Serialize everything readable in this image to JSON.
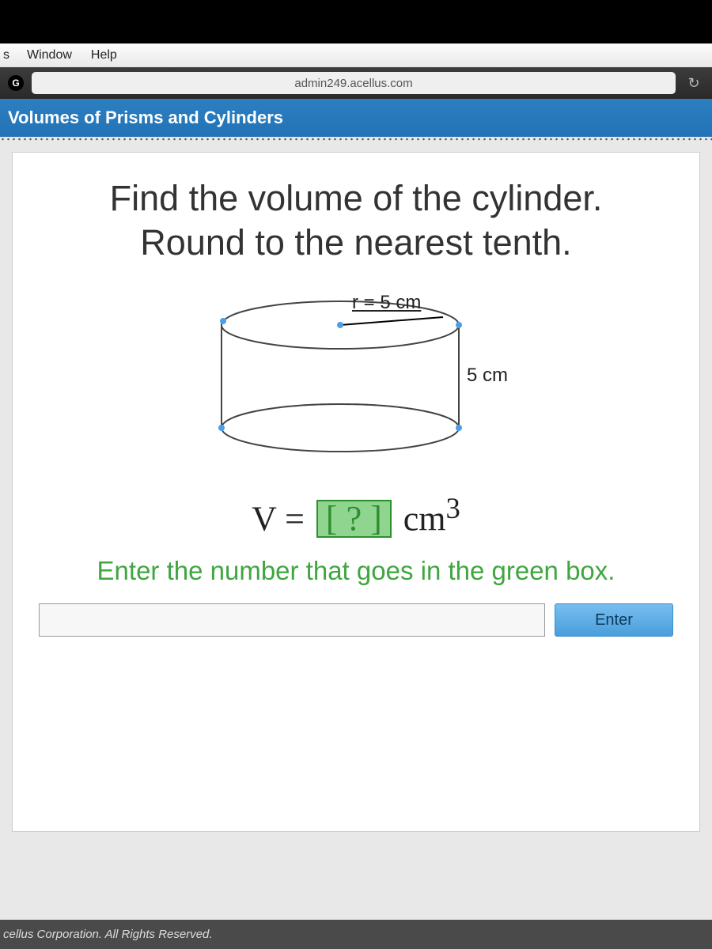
{
  "menubar": {
    "cut_item": "s",
    "item1": "Window",
    "item2": "Help"
  },
  "browser": {
    "url": "admin249.acellus.com"
  },
  "header": {
    "title": "Volumes of Prisms and Cylinders"
  },
  "problem": {
    "line1": "Find the volume of the cylinder.",
    "line2": "Round to the nearest tenth.",
    "radius_label": "r = 5 cm",
    "height_label": "5 cm",
    "formula_prefix": "V = ",
    "formula_placeholder": "?",
    "formula_suffix_unit": " cm",
    "formula_exponent": "3",
    "hint": "Enter the number that goes in the green box.",
    "enter_button": "Enter",
    "answer_value": ""
  },
  "footer": {
    "text": "cellus Corporation. All Rights Reserved."
  }
}
